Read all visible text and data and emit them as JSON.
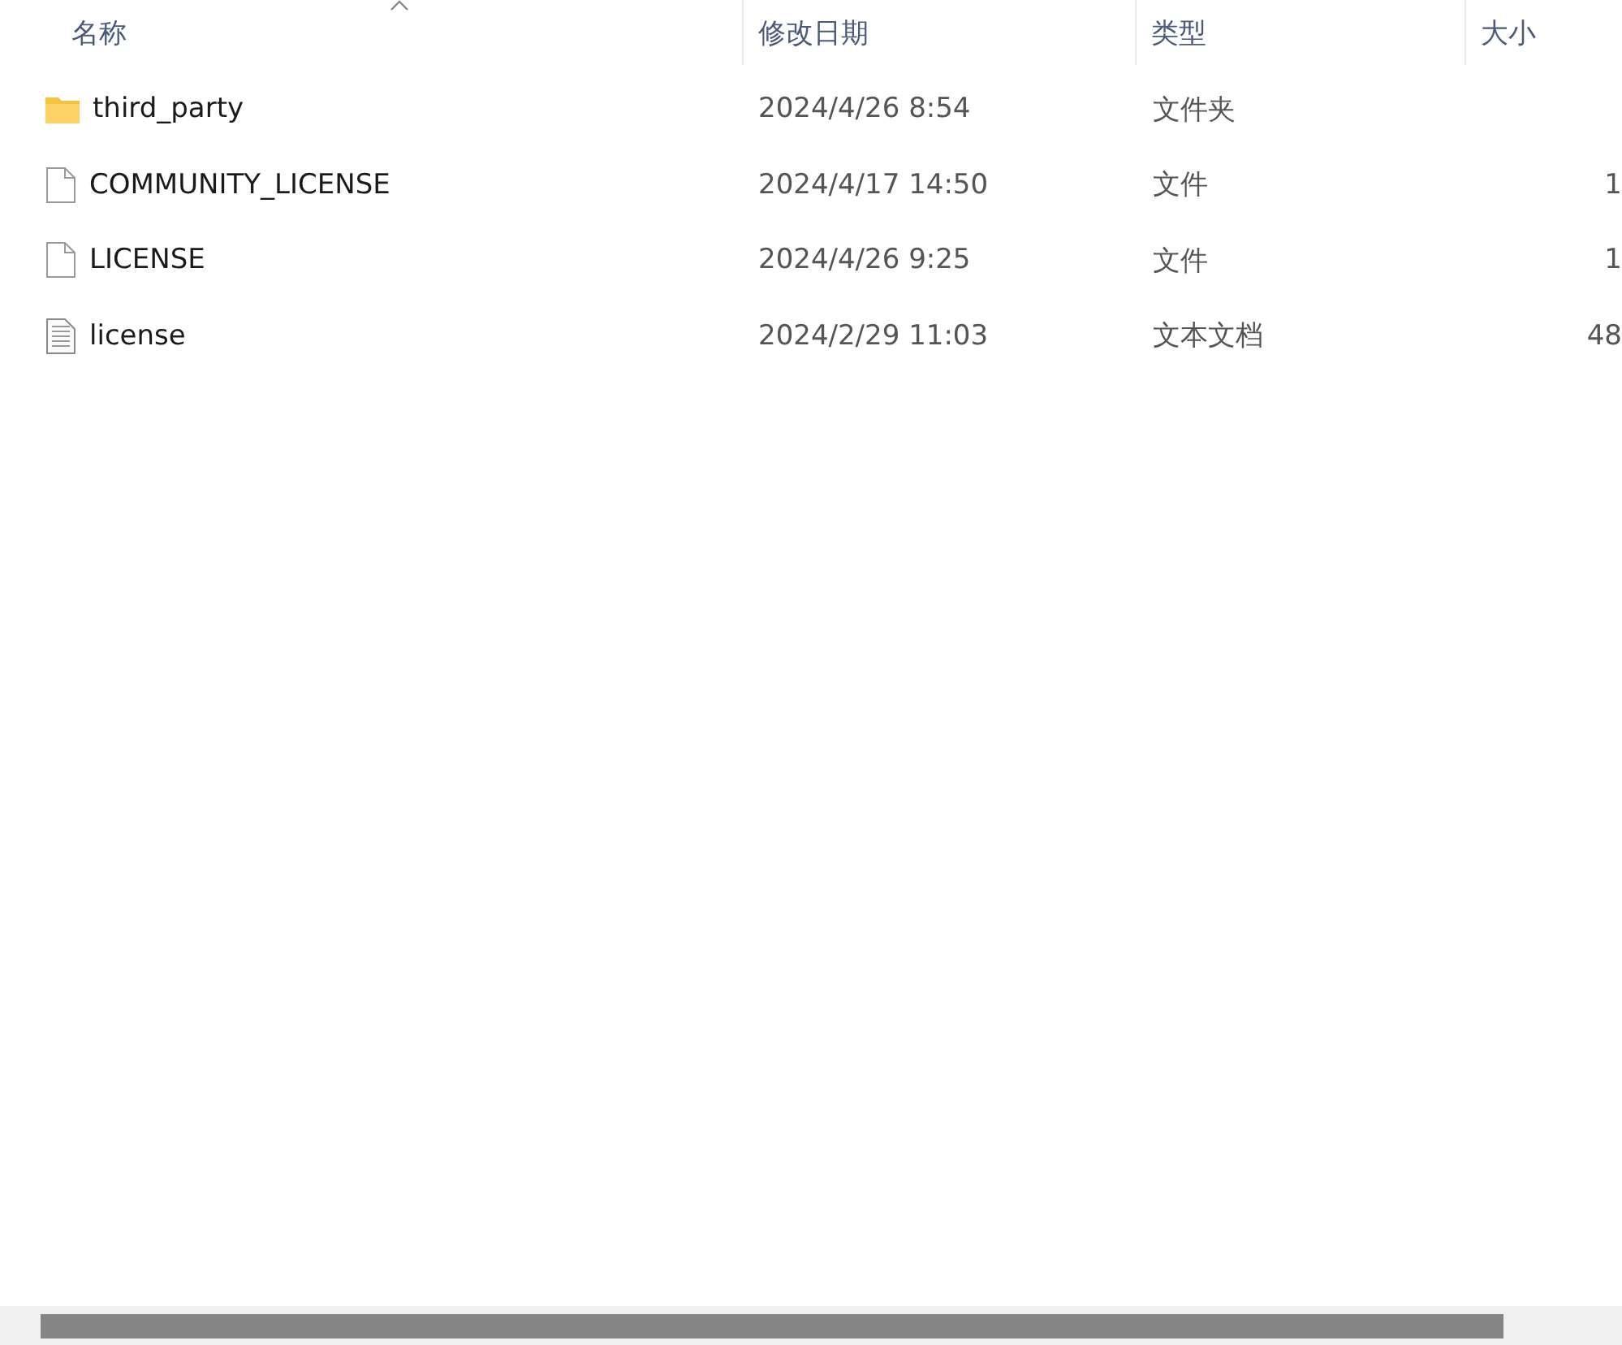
{
  "table": {
    "columns": [
      {
        "label": "名称",
        "sorted": true
      },
      {
        "label": "修改日期",
        "sorted": false
      },
      {
        "label": "类型",
        "sorted": false
      },
      {
        "label": "大小",
        "sorted": false
      }
    ],
    "rows": [
      {
        "kind": "folder",
        "name": "third_party",
        "modified": "2024/4/26 8:54",
        "type": "文件夹"
      },
      {
        "kind": "file",
        "name": "COMMUNITY_LICENSE",
        "modified": "2024/4/17 14:50",
        "type": "文件",
        "size": "1"
      },
      {
        "kind": "file",
        "name": "LICENSE",
        "modified": "2024/4/26 9:25",
        "type": "文件",
        "size": "1"
      },
      {
        "kind": "text",
        "name": "license",
        "modified": "2024/2/29 11:03",
        "type": "文本文档",
        "size": "48"
      }
    ]
  }
}
